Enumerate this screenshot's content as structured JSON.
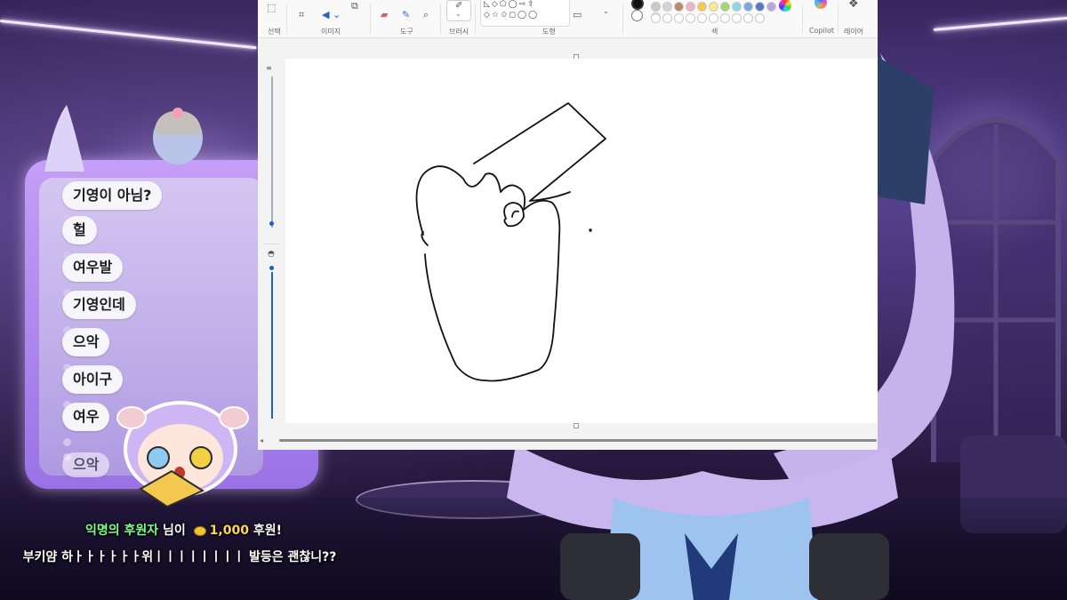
{
  "paint": {
    "groups": {
      "select": "선택",
      "image": "이미지",
      "tools": "도구",
      "brush": "브러시",
      "shapes": "도형",
      "colors": "색",
      "copilot": "Copilot",
      "layers": "레이어"
    },
    "palette": [
      "#c8c8c8",
      "#d4d4d4",
      "#b98a64",
      "#f0b2c8",
      "#f6c84b",
      "#f7ea8a",
      "#a2d96a",
      "#8ed6e6",
      "#7aa7d9",
      "#5a78c2",
      "#b8a6da",
      "#ffffff"
    ]
  },
  "chat": {
    "messages": [
      "기영이 아님?",
      "헐",
      "여우발",
      "기영인데",
      "으악",
      "아이구",
      "여우",
      "으악"
    ]
  },
  "alert": {
    "donor": "익명의 후원자",
    "suffix": " 님이 ",
    "coin_icon": "coin-icon",
    "amount": "1,000",
    "amount_suffix": " 후원!",
    "message": "부키얌 하ㅏㅏㅏㅏㅏㅏ위ㅣㅣㅣㅣㅣㅣㅣㅣ 발등은 괜찮니??",
    "donor_color": "#7dff8a",
    "amount_color": "#ffd84a"
  }
}
